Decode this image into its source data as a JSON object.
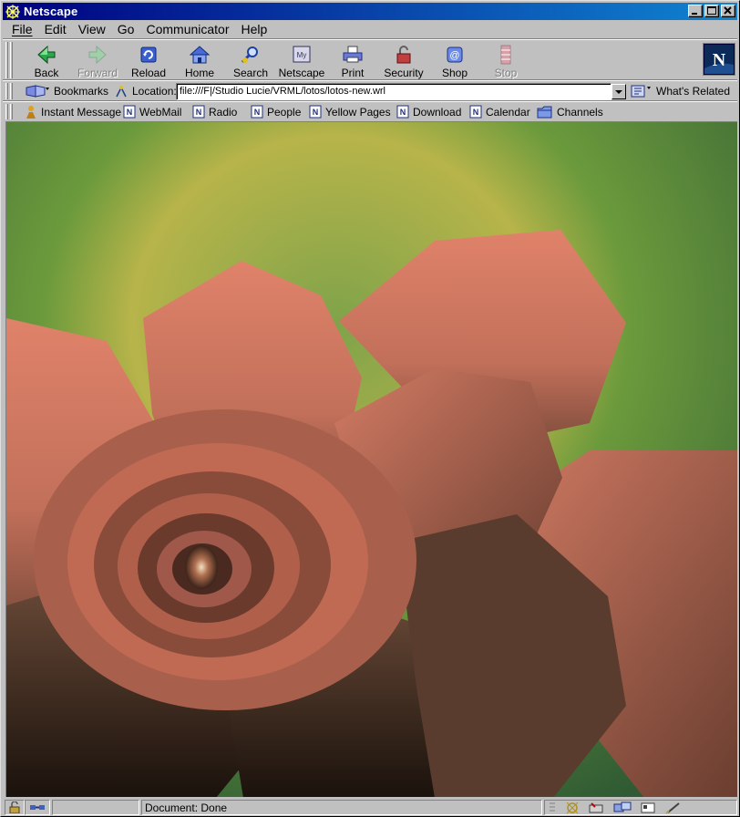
{
  "window": {
    "title": "Netscape"
  },
  "menu": {
    "items": [
      "File",
      "Edit",
      "View",
      "Go",
      "Communicator",
      "Help"
    ]
  },
  "navigation": {
    "buttons": [
      {
        "label": "Back",
        "icon": "back-arrow-icon",
        "enabled": true
      },
      {
        "label": "Forward",
        "icon": "forward-arrow-icon",
        "enabled": false
      },
      {
        "label": "Reload",
        "icon": "reload-icon",
        "enabled": true
      },
      {
        "label": "Home",
        "icon": "home-icon",
        "enabled": true
      },
      {
        "label": "Search",
        "icon": "search-icon",
        "enabled": true
      },
      {
        "label": "Netscape",
        "icon": "netscape-icon",
        "enabled": true
      },
      {
        "label": "Print",
        "icon": "print-icon",
        "enabled": true
      },
      {
        "label": "Security",
        "icon": "security-lock-icon",
        "enabled": true
      },
      {
        "label": "Shop",
        "icon": "shop-icon",
        "enabled": true
      },
      {
        "label": "Stop",
        "icon": "stop-icon",
        "enabled": false
      }
    ]
  },
  "location": {
    "bookmarks_label": "Bookmarks",
    "location_label": "Location:",
    "url": "file:///F|/Studio Lucie/VRML/lotos/lotos-new.wrl",
    "whats_related_label": "What's Related"
  },
  "personal_toolbar": {
    "items": [
      "Instant Message",
      "WebMail",
      "Radio",
      "People",
      "Yellow Pages",
      "Download",
      "Calendar",
      "Channels"
    ]
  },
  "status": {
    "text": "Document: Done"
  },
  "colors": {
    "titlebar_start": "#000080",
    "titlebar_end": "#1084d0",
    "chrome": "#c0c0c0"
  }
}
